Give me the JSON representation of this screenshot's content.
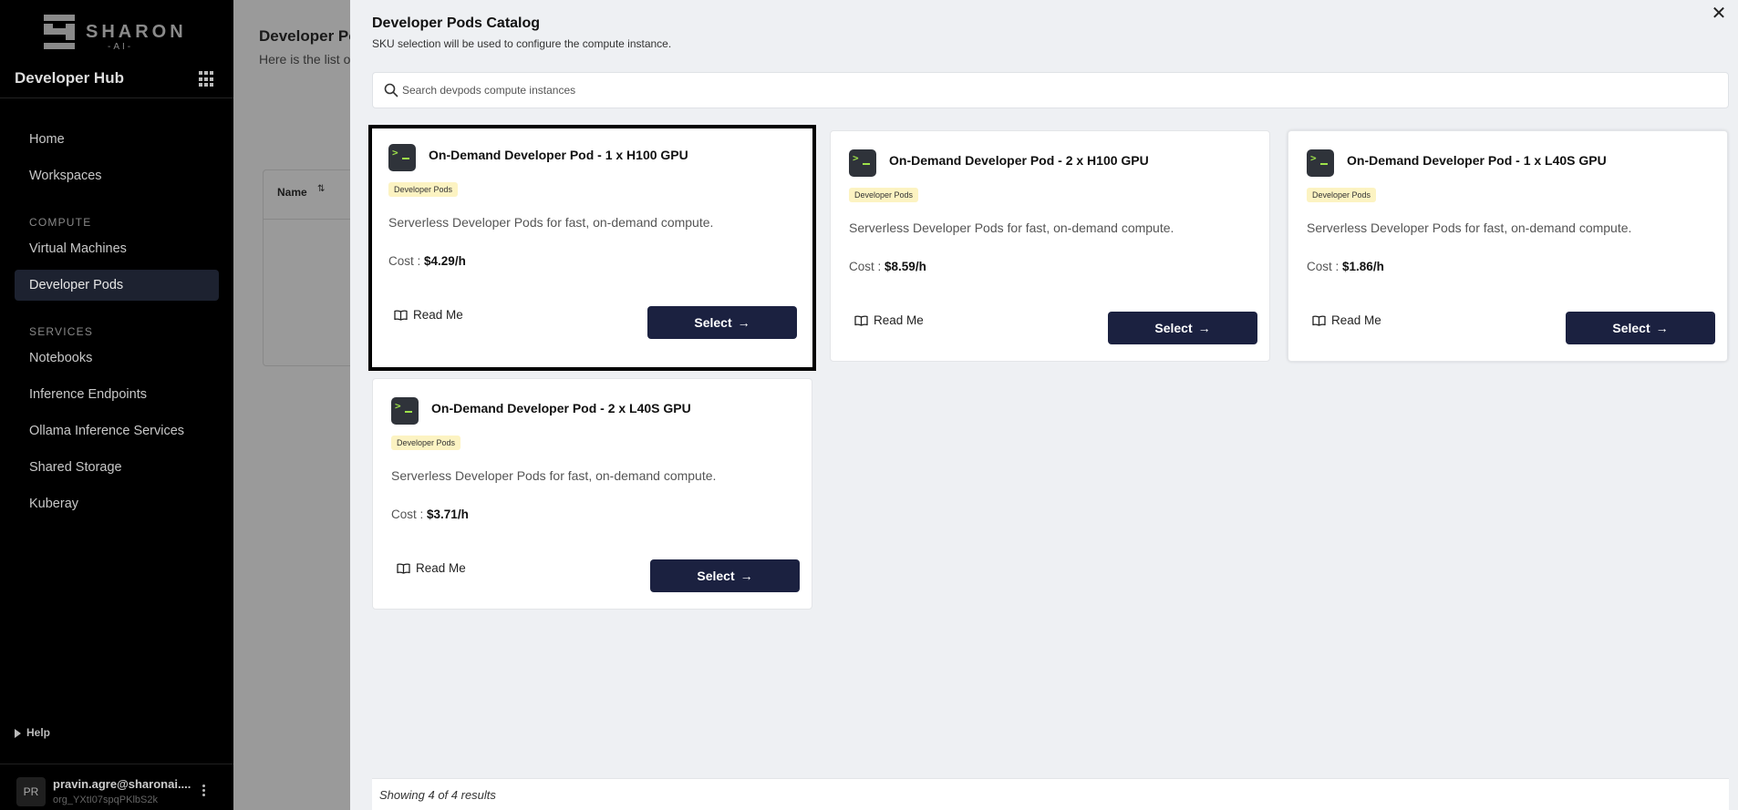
{
  "sidebar": {
    "brand": "SHARON",
    "brand_sub": "-AI-",
    "hub_title": "Developer Hub",
    "nav": [
      {
        "label": "Home"
      },
      {
        "label": "Workspaces"
      },
      {
        "section": "COMPUTE"
      },
      {
        "label": "Virtual Machines"
      },
      {
        "label": "Developer Pods",
        "active": true
      },
      {
        "section": "SERVICES"
      },
      {
        "label": "Notebooks"
      },
      {
        "label": "Inference Endpoints"
      },
      {
        "label": "Ollama Inference Services"
      },
      {
        "label": "Shared Storage"
      },
      {
        "label": "Kuberay"
      }
    ],
    "help_label": "Help",
    "user": {
      "initials": "PR",
      "email": "pravin.agre@sharonai....",
      "org": "org_YXtI07spqPKlbS2k"
    }
  },
  "background_page": {
    "title": "Developer Po",
    "subtitle": "Here is the list o",
    "table_header_name": "Name",
    "sort_icon": "sort-icon"
  },
  "drawer": {
    "title": "Developer Pods Catalog",
    "subtitle": "SKU selection will be used to configure the compute instance.",
    "close_icon": "close-icon",
    "search": {
      "placeholder": "Search devpods compute instances",
      "value": ""
    },
    "cards": [
      {
        "title": "On-Demand Developer Pod - 1 x H100 GPU",
        "badge": "Developer Pods",
        "description": "Serverless Developer Pods for fast, on-demand compute.",
        "cost_label": "Cost :",
        "cost": "$4.29/h",
        "readme_label": "Read Me",
        "select_label": "Select",
        "selected": true
      },
      {
        "title": "On-Demand Developer Pod - 2 x H100 GPU",
        "badge": "Developer Pods",
        "description": "Serverless Developer Pods for fast, on-demand compute.",
        "cost_label": "Cost :",
        "cost": "$8.59/h",
        "readme_label": "Read Me",
        "select_label": "Select",
        "selected": false
      },
      {
        "title": "On-Demand Developer Pod - 1 x L40S GPU",
        "badge": "Developer Pods",
        "description": "Serverless Developer Pods for fast, on-demand compute.",
        "cost_label": "Cost :",
        "cost": "$1.86/h",
        "readme_label": "Read Me",
        "select_label": "Select",
        "selected": false
      },
      {
        "title": "On-Demand Developer Pod - 2 x L40S GPU",
        "badge": "Developer Pods",
        "description": "Serverless Developer Pods for fast, on-demand compute.",
        "cost_label": "Cost :",
        "cost": "$3.71/h",
        "readme_label": "Read Me",
        "select_label": "Select",
        "selected": false
      }
    ],
    "results_text": "Showing 4 of 4 results",
    "colors": {
      "accent": "#1b2140",
      "badge_bg": "#fcf3c2",
      "terminal_green": "#9ee24a"
    }
  }
}
